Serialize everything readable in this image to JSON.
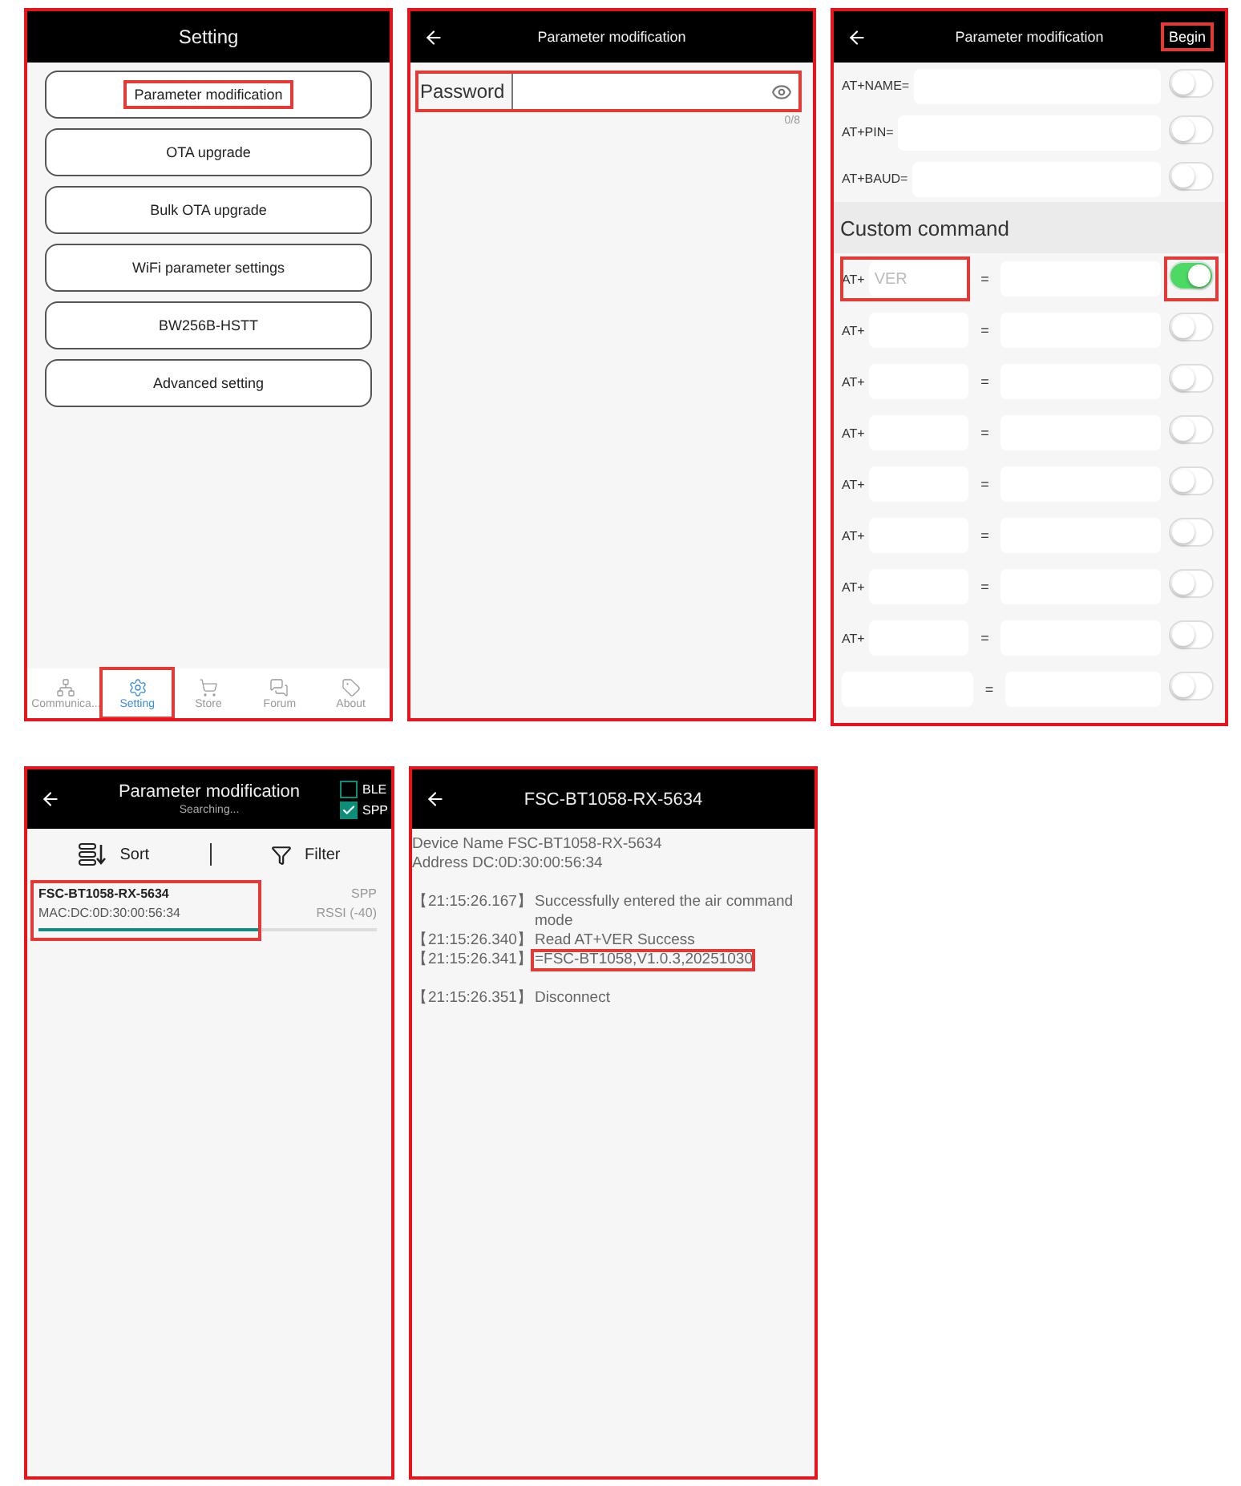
{
  "panels": [
    {
      "kind": "settings_menu",
      "header": {
        "title": "Setting"
      },
      "menu_items": [
        {
          "label": "Parameter modification",
          "highlighted": true
        },
        {
          "label": "OTA upgrade",
          "highlighted": false
        },
        {
          "label": "Bulk OTA upgrade",
          "highlighted": false
        },
        {
          "label": "WiFi parameter settings",
          "highlighted": false
        },
        {
          "label": "BW256B-HSTT",
          "highlighted": false
        },
        {
          "label": "Advanced setting",
          "highlighted": false
        }
      ],
      "tab_bar": [
        {
          "kind": "network",
          "label": "Communica...",
          "selected": false,
          "highlighted": false
        },
        {
          "kind": "settings",
          "label": "Setting",
          "selected": true,
          "highlighted": true
        },
        {
          "kind": "cart",
          "label": "Store",
          "selected": false,
          "highlighted": false
        },
        {
          "kind": "chat",
          "label": "Forum",
          "selected": false,
          "highlighted": false
        },
        {
          "kind": "tag",
          "label": "About",
          "selected": false,
          "highlighted": false
        }
      ]
    },
    {
      "kind": "password",
      "header": {
        "title": "Parameter modification"
      },
      "password": {
        "label": "Password",
        "counter": "0/8",
        "highlighted": true
      }
    },
    {
      "kind": "at_commands",
      "header": {
        "title": "Parameter modification",
        "action": "Begin",
        "action_highlighted": true
      },
      "fixed_commands": [
        {
          "label": "AT+NAME=",
          "on": false
        },
        {
          "label": "AT+PIN=",
          "on": false
        },
        {
          "label": "AT+BAUD=",
          "on": false
        }
      ],
      "section_title": "Custom command",
      "custom_commands": [
        {
          "prefix": "AT+",
          "placeholder": "VER",
          "equals": "=",
          "on": true,
          "field_highlighted": true,
          "toggle_highlighted": true
        },
        {
          "prefix": "AT+",
          "equals": "=",
          "on": false,
          "field_highlighted": false,
          "toggle_highlighted": false
        },
        {
          "prefix": "AT+",
          "equals": "=",
          "on": false,
          "field_highlighted": false,
          "toggle_highlighted": false
        },
        {
          "prefix": "AT+",
          "equals": "=",
          "on": false,
          "field_highlighted": false,
          "toggle_highlighted": false
        },
        {
          "prefix": "AT+",
          "equals": "=",
          "on": false,
          "field_highlighted": false,
          "toggle_highlighted": false
        },
        {
          "prefix": "AT+",
          "equals": "=",
          "on": false,
          "field_highlighted": false,
          "toggle_highlighted": false
        },
        {
          "prefix": "AT+",
          "equals": "=",
          "on": false,
          "field_highlighted": false,
          "toggle_highlighted": false
        },
        {
          "prefix": "AT+",
          "equals": "=",
          "on": false,
          "field_highlighted": false,
          "toggle_highlighted": false
        },
        {
          "equals": "=",
          "on": false,
          "field_highlighted": false,
          "toggle_highlighted": false
        }
      ]
    },
    {
      "kind": "device_scan",
      "header": {
        "title": "Parameter modification",
        "subtitle": "Searching...",
        "filters": [
          {
            "label": "BLE",
            "checked": false
          },
          {
            "label": "SPP",
            "checked": true
          }
        ]
      },
      "toolbar": {
        "sort": "Sort",
        "filter": "Filter"
      },
      "devices": [
        {
          "name": "FSC-BT1058-RX-5634",
          "mac": "MAC:DC:0D:30:00:56:34",
          "type": "SPP",
          "rssi": "RSSI (-40)",
          "level": 0.66,
          "highlighted": true
        }
      ]
    },
    {
      "kind": "log",
      "header": {
        "title": "FSC-BT1058-RX-5634"
      },
      "info": [
        "Device Name FSC-BT1058-RX-5634",
        "Address DC:0D:30:00:56:34"
      ],
      "entries": [
        {
          "time": "【21:15:26.167】",
          "message": "Successfully entered the air command mode",
          "highlighted": false,
          "separated": true
        },
        {
          "time": "【21:15:26.340】",
          "message": "Read AT+VER Success",
          "highlighted": false,
          "separated": false
        },
        {
          "time": "【21:15:26.341】",
          "message": "=FSC-BT1058,V1.0.3,20251030",
          "highlighted": true,
          "separated": false
        },
        {
          "time": "【21:15:26.351】",
          "message": "Disconnect",
          "highlighted": false,
          "separated": true
        }
      ]
    }
  ]
}
